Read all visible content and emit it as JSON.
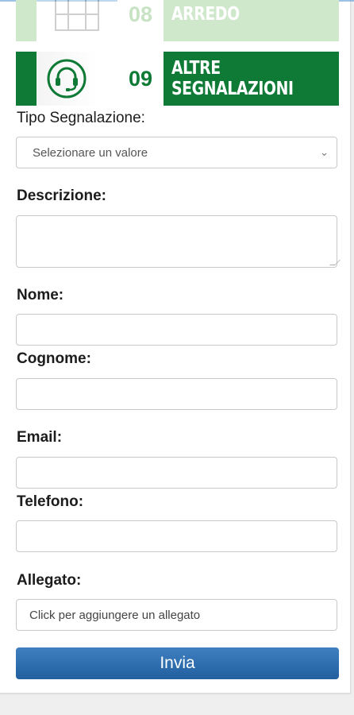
{
  "categories": [
    {
      "number": "08",
      "label": "ARREDO"
    },
    {
      "number": "09",
      "label_line1": "ALTRE",
      "label_line2": "SEGNALAZIONI"
    }
  ],
  "colors": {
    "green": "#0e7a36",
    "green_faded": "#cfe8cc",
    "button_blue": "#2d6fb0"
  },
  "icons": {
    "row08": "furniture-icon",
    "row09": "headset-icon"
  },
  "form": {
    "tipo_label": "Tipo Segnalazione:",
    "tipo_selected": "Selezionare un valore",
    "descrizione_label": "Descrizione:",
    "nome_label": "Nome:",
    "cognome_label": "Cognome:",
    "email_label": "Email:",
    "telefono_label": "Telefono:",
    "allegato_label": "Allegato:",
    "allegato_placeholder": "Click per aggiungere un allegato",
    "submit_label": "Invia"
  }
}
